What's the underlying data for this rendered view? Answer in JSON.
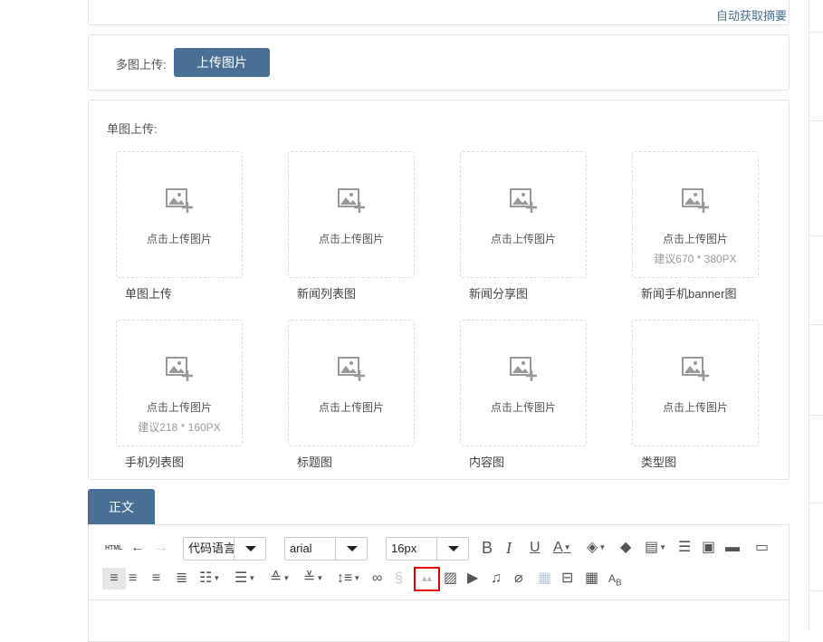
{
  "summary": {
    "auto_link": "自动获取摘要"
  },
  "multi_upload": {
    "label": "多图上传:",
    "button": "上传图片"
  },
  "single_upload": {
    "label": "单图上传:",
    "cards": [
      {
        "prompt": "点击上传图片",
        "hint": "",
        "label": "单图上传"
      },
      {
        "prompt": "点击上传图片",
        "hint": "",
        "label": "新闻列表图"
      },
      {
        "prompt": "点击上传图片",
        "hint": "",
        "label": "新闻分享图"
      },
      {
        "prompt": "点击上传图片",
        "hint": "建议670 * 380PX",
        "label": "新闻手机banner图"
      },
      {
        "prompt": "点击上传图片",
        "hint": "建议218 * 160PX",
        "label": "手机列表图"
      },
      {
        "prompt": "点击上传图片",
        "hint": "",
        "label": "标题图"
      },
      {
        "prompt": "点击上传图片",
        "hint": "",
        "label": "内容图"
      },
      {
        "prompt": "点击上传图片",
        "hint": "",
        "label": "类型图"
      }
    ]
  },
  "editor": {
    "tab": "正文",
    "html_label": "HTML",
    "code_lang": "代码语言",
    "font_family": "arial",
    "font_size": "16px",
    "highlight_color": "#e00000",
    "accent": "#4a6f94"
  }
}
